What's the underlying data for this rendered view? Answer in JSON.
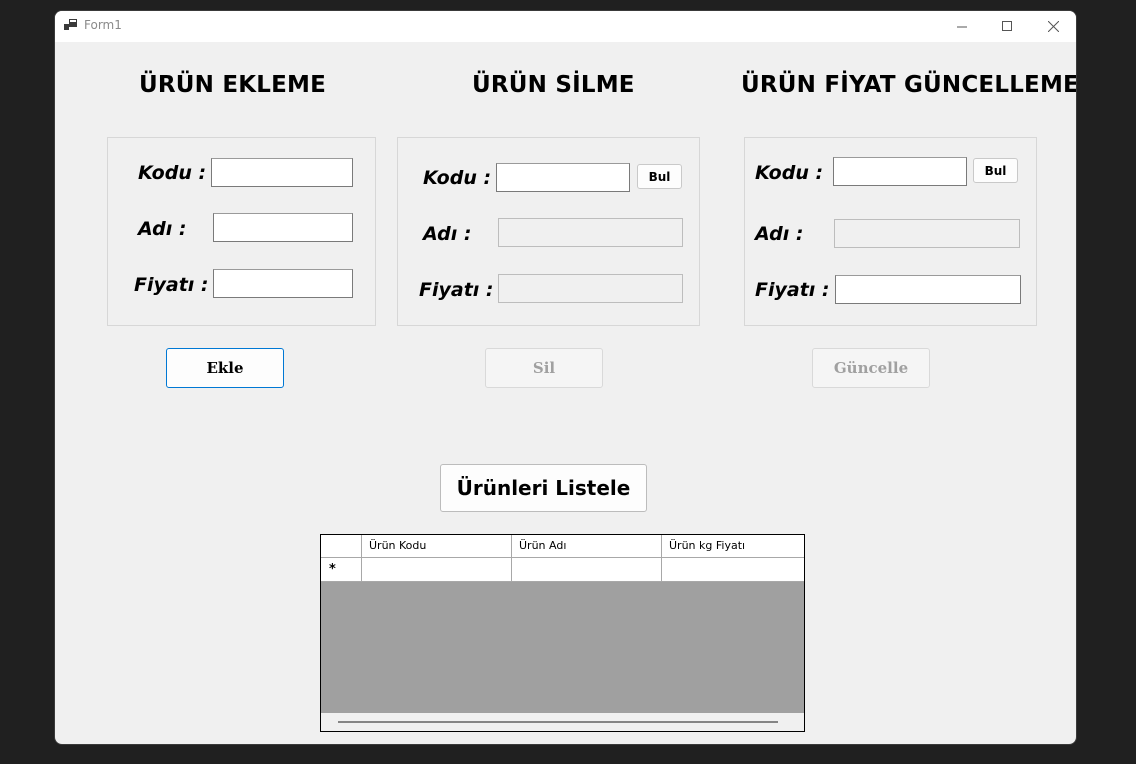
{
  "window": {
    "title": "Form1",
    "icons": {
      "app": "app-icon",
      "minimize": "minimize-icon",
      "maximize": "maximize-icon",
      "close": "close-icon"
    }
  },
  "add_section": {
    "title": "ÜRÜN EKLEME",
    "labels": {
      "code": "Kodu :",
      "name": "Adı :",
      "price": "Fiyatı :"
    },
    "values": {
      "code": "",
      "name": "",
      "price": ""
    },
    "button": "Ekle"
  },
  "delete_section": {
    "title": "ÜRÜN SİLME",
    "labels": {
      "code": "Kodu :",
      "name": "Adı :",
      "price": "Fiyatı :"
    },
    "values": {
      "code": "",
      "name": "",
      "price": ""
    },
    "find_button": "Bul",
    "button": "Sil"
  },
  "update_section": {
    "title": "ÜRÜN FİYAT GÜNCELLEME",
    "labels": {
      "code": "Kodu :",
      "name": "Adı :",
      "price": "Fiyatı :"
    },
    "values": {
      "code": "",
      "name": "",
      "price": ""
    },
    "find_button": "Bul",
    "button": "Güncelle"
  },
  "list_button": "Ürünleri Listele",
  "grid": {
    "columns": [
      "Ürün Kodu",
      "Ürün Adı",
      "Ürün kg Fiyatı"
    ],
    "new_row_marker": "*"
  },
  "colors": {
    "focus_border": "#0078d4",
    "window_bg": "#f0f0f0",
    "grid_bg": "#a0a0a0"
  }
}
